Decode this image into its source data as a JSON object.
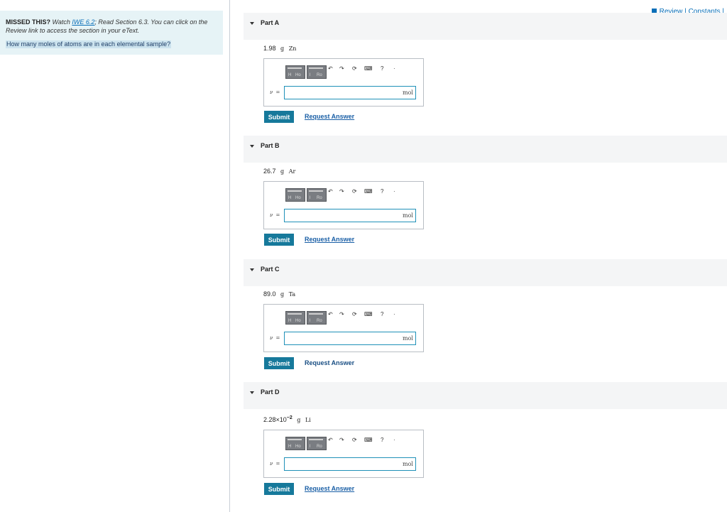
{
  "left_panel": {
    "missed_label": "MISSED THIS?",
    "watch_text": "Watch",
    "iwe_link": "IWE 6.2",
    "read_text": "; Read Section 6.3. You can click on the Review link to access the section in your eText.",
    "question": "How many moles of atoms are in each elemental sample?"
  },
  "header_links": {
    "review": "Review",
    "separator": "|",
    "constants": "Constants",
    "trailing": "|"
  },
  "parts": [
    {
      "title": "Part A",
      "amount": "1.98",
      "unit": "g",
      "element": "Zn",
      "variable": "ν",
      "equals": "=",
      "input_value": "",
      "answer_unit": "mol",
      "submit_label": "Submit",
      "request_label": "Request Answer"
    },
    {
      "title": "Part B",
      "amount": "26.7",
      "unit": "g",
      "element": "Ar",
      "variable": "ν",
      "equals": "=",
      "input_value": "",
      "answer_unit": "mol",
      "submit_label": "Submit",
      "request_label": "Request Answer"
    },
    {
      "title": "Part C",
      "amount": "89.0",
      "unit": "g",
      "element": "Ta",
      "variable": "ν",
      "equals": "=",
      "input_value": "",
      "answer_unit": "mol",
      "submit_label": "Submit",
      "request_label": "Request Answer"
    },
    {
      "title": "Part D",
      "amount": "2.28×10",
      "exponent": "−2",
      "unit": "g",
      "element": "Li",
      "variable": "ν",
      "equals": "=",
      "input_value": "",
      "answer_unit": "mol",
      "submit_label": "Submit",
      "request_label": "Request Answer"
    }
  ],
  "toolbar": {
    "templates_label": "H",
    "templates_label2": "Ho",
    "symbols_label": "l",
    "symbols_label2": "Ro",
    "undo_icon": "undo-icon",
    "redo_icon": "redo-icon",
    "reset_icon": "reset-icon",
    "keyboard_icon": "keyboard-icon",
    "help_icon": "help-icon",
    "undo_glyph": "↶",
    "redo_glyph": "↷",
    "reset_glyph": "⟳",
    "keyboard_glyph": "⌨",
    "help_glyph": "?",
    "more_glyph": "·"
  },
  "colors": {
    "accent": "#16799b",
    "link": "#0a6fb8",
    "info_bg": "#e6f3f6",
    "input_border": "#1f91b8"
  }
}
